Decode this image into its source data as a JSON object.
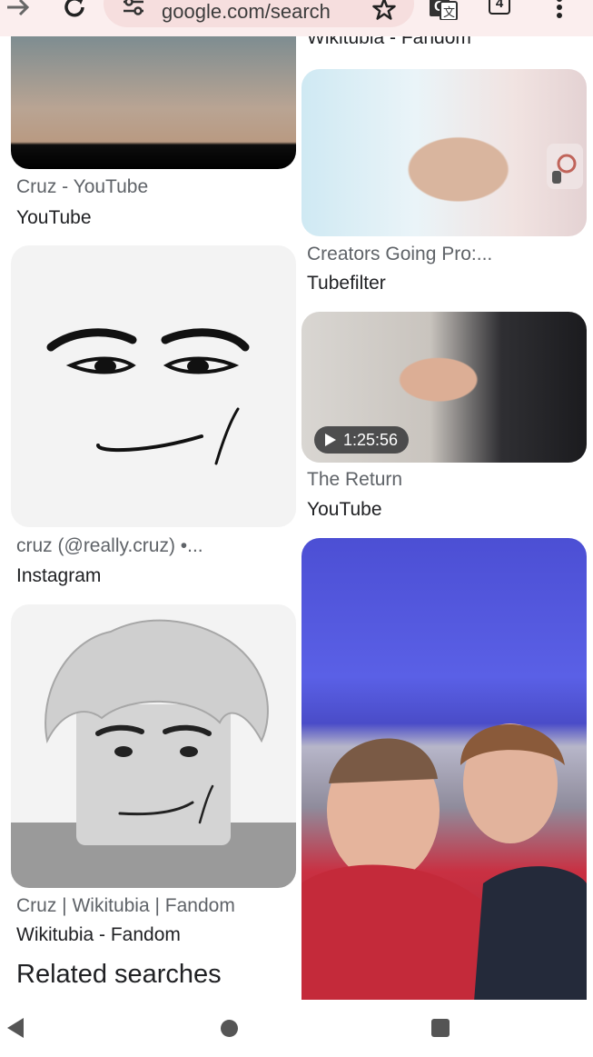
{
  "browser": {
    "url": "google.com/search",
    "tab_count": "4",
    "icons": [
      "forward-icon",
      "reload-icon",
      "tune-icon",
      "star-icon",
      "translate-icon",
      "tabs-icon",
      "more-vert-icon"
    ]
  },
  "results": {
    "cutoff_source": "Wikitubia - Fandom",
    "items": [
      {
        "title": "Cruz - YouTube",
        "source": "YouTube"
      },
      {
        "title": "Creators Going Pro:...",
        "source": "Tubefilter"
      },
      {
        "title": "cruz (@really.cruz) •...",
        "source": "Instagram"
      },
      {
        "title": "The Return",
        "source": "YouTube",
        "duration": "1:25:56"
      },
      {
        "title": "Cruz | Wikitubia | Fandom",
        "source": "Wikitubia - Fandom"
      }
    ]
  },
  "related": {
    "heading": "Related searches"
  },
  "colors": {
    "topbar_bg": "#fbeeee",
    "url_pill_bg": "#f6dede",
    "title_text": "#5f6368",
    "source_text": "#202124"
  }
}
